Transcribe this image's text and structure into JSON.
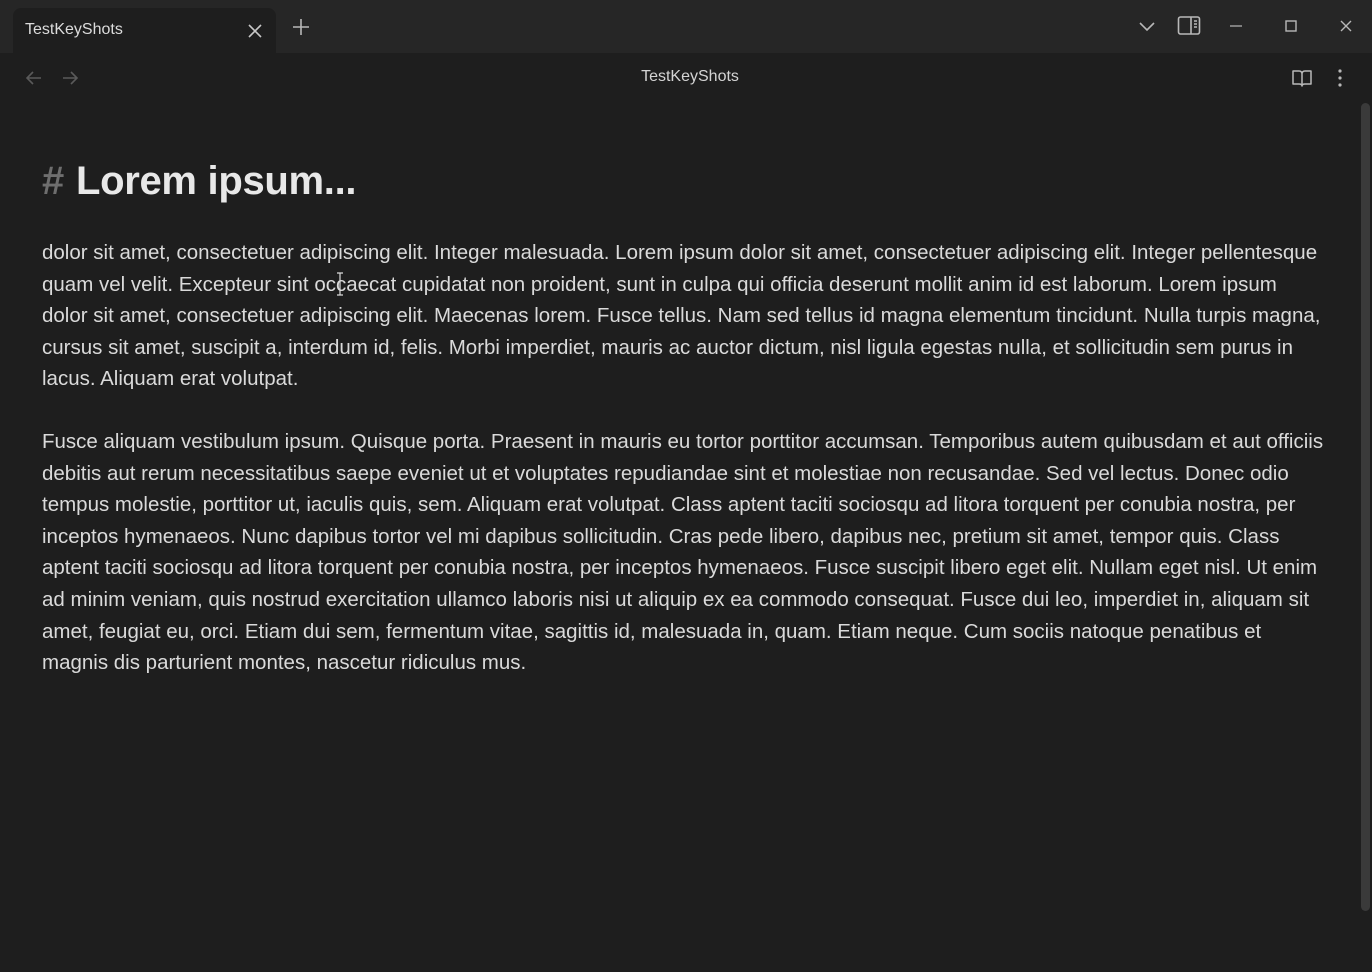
{
  "titlebar": {
    "tab_label": "TestKeyShots",
    "icons": {
      "tab_close": "close-icon",
      "new_tab": "plus-icon",
      "tab_list": "chevron-down-icon",
      "sidebar_toggle": "sidebar-right-icon",
      "minimize": "minimize-icon",
      "maximize": "maximize-icon",
      "close_window": "close-icon"
    }
  },
  "navbar": {
    "title": "TestKeyShots",
    "icons": {
      "back": "arrow-left-icon",
      "forward": "arrow-right-icon",
      "reading_view": "book-open-icon",
      "more_options": "more-vertical-icon"
    }
  },
  "document": {
    "heading_marker": "#",
    "heading": "Lorem ipsum...",
    "paragraphs": [
      "dolor sit amet, consectetuer adipiscing elit. Integer malesuada. Lorem ipsum dolor sit amet, consectetuer adipiscing elit. Integer pellentesque quam vel velit. Excepteur sint occaecat cupidatat non proident, sunt in culpa qui officia deserunt mollit anim id est laborum. Lorem ipsum dolor sit amet, consectetuer adipiscing elit. Maecenas lorem. Fusce tellus. Nam sed tellus id magna elementum tincidunt. Nulla turpis magna, cursus sit amet, suscipit a, interdum id, felis. Morbi imperdiet, mauris ac auctor dictum, nisl ligula egestas nulla, et sollicitudin sem purus in lacus. Aliquam erat volutpat.",
      "Fusce aliquam vestibulum ipsum. Quisque porta. Praesent in mauris eu tortor porttitor accumsan. Temporibus autem quibusdam et aut officiis debitis aut rerum necessitatibus saepe eveniet ut et voluptates repudiandae sint et molestiae non recusandae. Sed vel lectus. Donec odio tempus molestie, porttitor ut, iaculis quis, sem. Aliquam erat volutpat. Class aptent taciti sociosqu ad litora torquent per conubia nostra, per inceptos hymenaeos. Nunc dapibus tortor vel mi dapibus sollicitudin. Cras pede libero, dapibus nec, pretium sit amet, tempor quis. Class aptent taciti sociosqu ad litora torquent per conubia nostra, per inceptos hymenaeos. Fusce suscipit libero eget elit. Nullam eget nisl. Ut enim ad minim veniam, quis nostrud exercitation ullamco laboris nisi ut aliquip ex ea commodo consequat. Fusce dui leo, imperdiet in, aliquam sit amet, feugiat eu, orci. Etiam dui sem, fermentum vitae, sagittis id, malesuada in, quam. Etiam neque. Cum sociis natoque penatibus et magnis dis parturient montes, nascetur ridiculus mus."
    ]
  },
  "colors": {
    "background": "#1e1e1e",
    "titlebar": "#262626",
    "text": "#dadada",
    "heading_marker": "#6e6e6e"
  }
}
